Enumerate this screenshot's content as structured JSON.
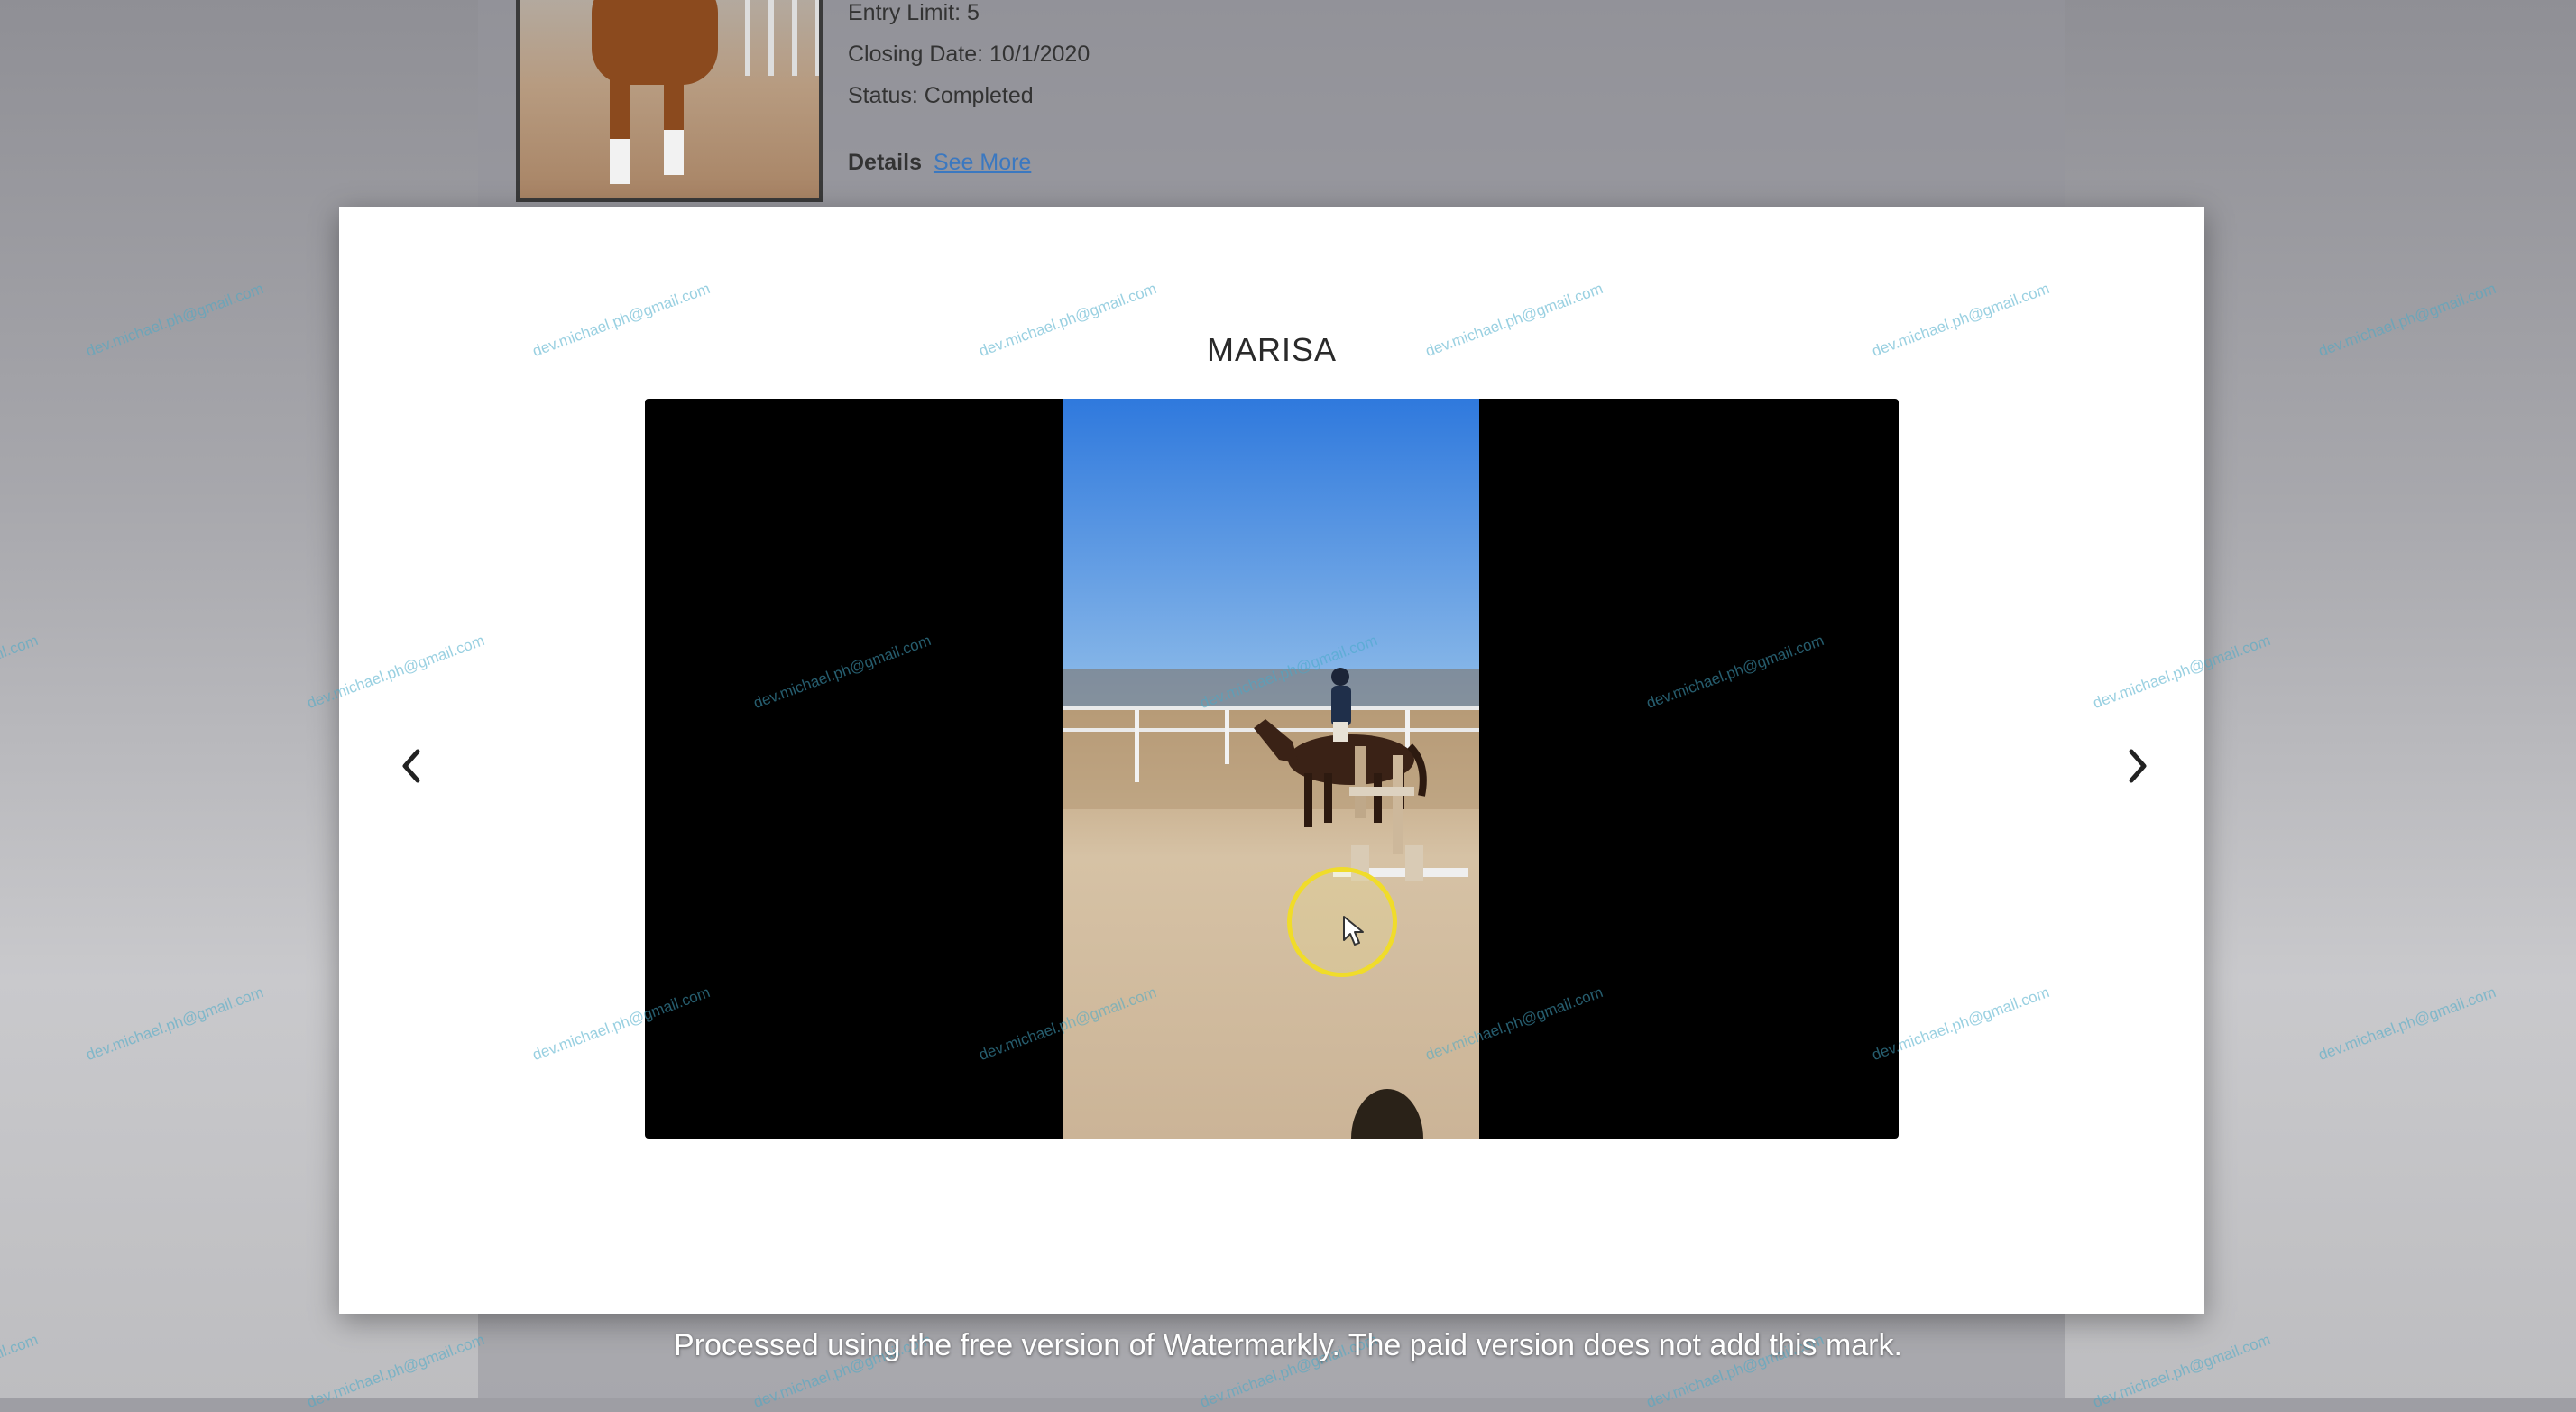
{
  "background_card": {
    "entry_limit": "Entry Limit: 5",
    "closing_date": "Closing Date: 10/1/2020",
    "status": "Status: Completed",
    "details_label": "Details",
    "details_link": "See More"
  },
  "modal": {
    "title": "MARISA",
    "prev_icon": "chevron-left-icon",
    "next_icon": "chevron-right-icon"
  },
  "watermark": {
    "text": "dev.michael.ph@gmail.com",
    "color": "#46aac8"
  },
  "caption": "Processed using the free version of Watermarkly. The paid version does not add this mark.",
  "colors": {
    "link": "#3b78c0",
    "cursor_ring": "#f0dc2a",
    "sky": "#3f86e0",
    "sand": "#cdb79a"
  }
}
